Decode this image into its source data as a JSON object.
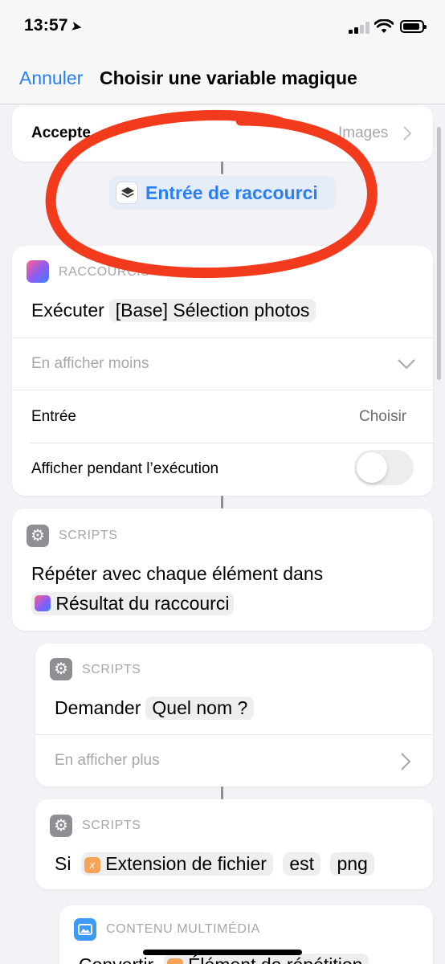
{
  "status": {
    "time": "13:57"
  },
  "nav": {
    "cancel": "Annuler",
    "title": "Choisir une variable magique"
  },
  "accept_card": {
    "label": "Accepte",
    "value": "Images"
  },
  "magic_variable": {
    "label": "Entrée de raccourci"
  },
  "run_shortcut": {
    "category": "RACCOURCIS",
    "action": "Exécuter",
    "shortcut_name": "[Base] Sélection photos",
    "show_less": "En afficher moins",
    "input_label": "Entrée",
    "input_value": "Choisir",
    "show_while_running": "Afficher pendant l’exécution"
  },
  "repeat": {
    "category": "SCRIPTS",
    "text": "Répéter avec chaque élément dans",
    "variable": "Résultat du raccourci"
  },
  "ask": {
    "category": "SCRIPTS",
    "action": "Demander",
    "question": "Quel nom ?",
    "show_more": "En afficher plus"
  },
  "if_block": {
    "category": "SCRIPTS",
    "word": "Si",
    "variable": "Extension de fichier",
    "operator": "est",
    "value": "png"
  },
  "media": {
    "category": "CONTENU MULTIMÉDIA",
    "action": "Convertir",
    "variable": "Élément de répétition"
  },
  "colors": {
    "accent": "#2a7ef6",
    "annotation": "#f23a1c"
  },
  "icons": [
    "location-arrow-icon",
    "signal-icon",
    "wifi-icon",
    "battery-icon",
    "chevron-right-icon",
    "chevron-down-icon",
    "shortcuts-icon",
    "gear-icon",
    "variable-x-icon",
    "media-icon",
    "layers-icon"
  ]
}
